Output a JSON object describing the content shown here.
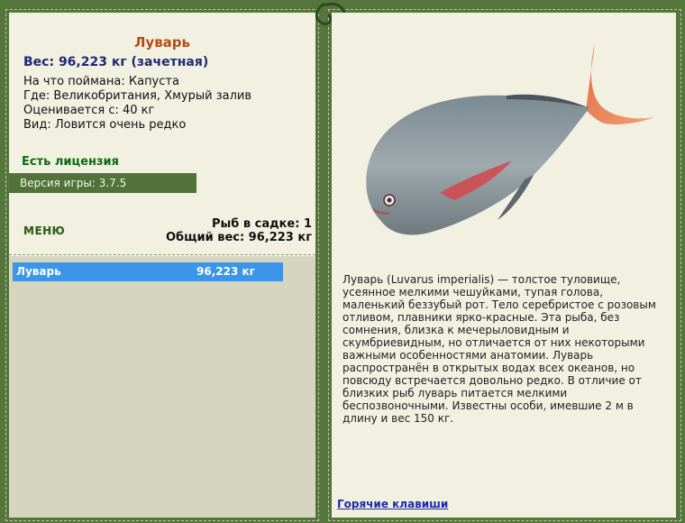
{
  "fish": {
    "name": "Луварь",
    "weight_line": "Вес: 96,223 кг (зачетная)",
    "caught_on": "На что поймана: Капуста",
    "location": "Где: Великобритания, Хмурый залив",
    "valued_from": "Оценивается с: 40 кг",
    "rarity": "Вид: Ловится очень редко",
    "description": "Луварь (Luvarus imperialis) — толстое туловище, усеянное мелкими чешуйками, тупая голова, маленький беззубый рот. Тело серебристое с розовым отливом, плавники ярко-красные. Эта рыба, без сомнения, близка к мечерыловидным и скумбриевидным, но отличается от них некоторыми важными особенностями анатомии. Луварь распространён в открытых водах всех океанов, но повсюду встречается довольно редко. В отличие от близких рыб луварь питается мелкими беспозвоночными. Известны особи, имевшие 2 м в длину и вес 150 кг."
  },
  "license": "Есть лицензия",
  "version": "Версия игры: 3.7.5",
  "menu_label": "МЕНЮ",
  "cage": {
    "count": "Рыб в садке: 1",
    "total": "Общий вес: 96,223 кг"
  },
  "cage_list": [
    {
      "name": "Луварь",
      "weight": "96,223 кг"
    }
  ],
  "hotkeys_label": "Горячие клавиши",
  "colors": {
    "frame": "#55753c",
    "panel": "#f1f0e1",
    "title": "#b84a14",
    "weight": "#1b2a78",
    "license": "#0b6b12",
    "selected_row": "#3b95e8",
    "link": "#1c2aa8"
  }
}
